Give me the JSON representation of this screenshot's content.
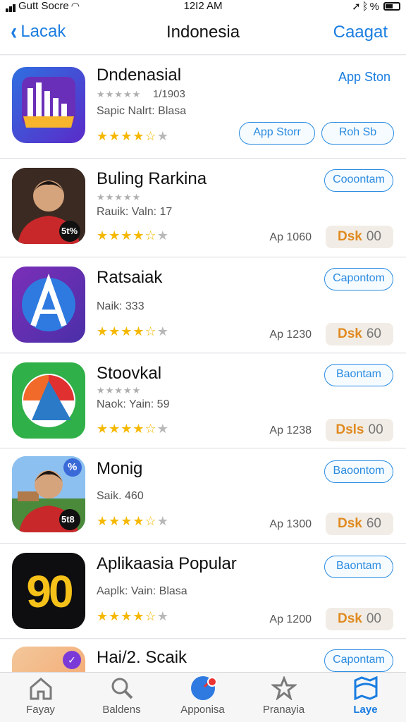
{
  "status": {
    "carrier": "Gutt Socre",
    "time": "12I2 AM",
    "right_icons": "location-bluetooth-battery"
  },
  "nav": {
    "back_label": "Lacak",
    "title": "Indonesia",
    "right_label": "Caagat"
  },
  "apps": [
    {
      "name": "Dndenasial",
      "stars_small": "★★★★★",
      "count": "1/1903",
      "sub": "Sapic Nalrt: Blasa",
      "rating": 4,
      "link": "App Ston",
      "btn1": "App Storr",
      "btn2": "Roh Sb"
    },
    {
      "name": "Buling Rarkina",
      "stars_small": "★★★★★",
      "sub": "Rauik: Valn: 17",
      "rating": 4,
      "btn": "Cooontam",
      "price": "Ap 1060",
      "dl_a": "Dsk",
      "dl_b": "00",
      "icon_badge": "5t%"
    },
    {
      "name": "Ratsaiak",
      "sub": "Naik: 333",
      "rating": 4,
      "btn": "Capontom",
      "price": "Ap 1230",
      "dl_a": "Dsk",
      "dl_b": "60"
    },
    {
      "name": "Stoovkal",
      "stars_small": "★★★★★",
      "sub": "Naok: Yain: 59",
      "rating": 4,
      "btn": "Baontam",
      "price": "Ap 1238",
      "dl_a": "Dsls",
      "dl_b": "00"
    },
    {
      "name": "Monig",
      "sub": "Saik. 460",
      "rating": 4,
      "btn": "Baoontom",
      "price": "Ap 1300",
      "dl_a": "Dsk",
      "dl_b": "60",
      "icon_badge": "5t8",
      "icon_badge2": "%"
    },
    {
      "name": "Aplikaasia Popular",
      "sub": "Aaplk: Vain: Blasa",
      "rating": 4,
      "btn": "Baontam",
      "price": "Ap 1200",
      "dl_a": "Dsk",
      "dl_b": "00",
      "icon_text": "90"
    },
    {
      "name": "Hai/2. Scaik",
      "btn": "Capontam"
    }
  ],
  "tabs": [
    {
      "label": "Fayay",
      "icon": "home-icon"
    },
    {
      "label": "Baldens",
      "icon": "search-icon"
    },
    {
      "label": "Apponisa",
      "icon": "compass-icon"
    },
    {
      "label": "Pranayia",
      "icon": "star-icon"
    },
    {
      "label": "Laye",
      "icon": "map-icon"
    }
  ],
  "colors": {
    "accent": "#1a7de0",
    "star": "#f5b800",
    "download_accent": "#e08a20"
  }
}
